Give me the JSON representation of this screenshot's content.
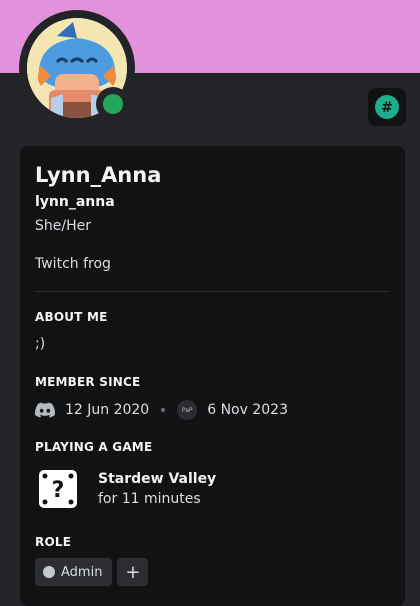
{
  "profile": {
    "display_name": "Lynn_Anna",
    "username": "lynn_anna",
    "pronouns": "She/Her",
    "custom_status": "Twitch frog",
    "status": "online",
    "status_color": "#23a55a",
    "banner_color": "#e292dd"
  },
  "badge": {
    "icon": "hashtag-icon",
    "glyph": "#"
  },
  "sections": {
    "about_title": "ABOUT ME",
    "about_text": ";)",
    "member_title": "MEMBER SINCE",
    "discord_date": "12 Jun 2020",
    "server_icon_text": "PaP",
    "server_date": "6 Nov 2023",
    "playing_title": "PLAYING A GAME",
    "role_title": "ROLE"
  },
  "game": {
    "name": "Stardew Valley",
    "time": "for 11 minutes",
    "icon_glyph": "?"
  },
  "roles": [
    {
      "name": "Admin",
      "color": "#c4c9ce"
    }
  ],
  "add_role_glyph": "+"
}
